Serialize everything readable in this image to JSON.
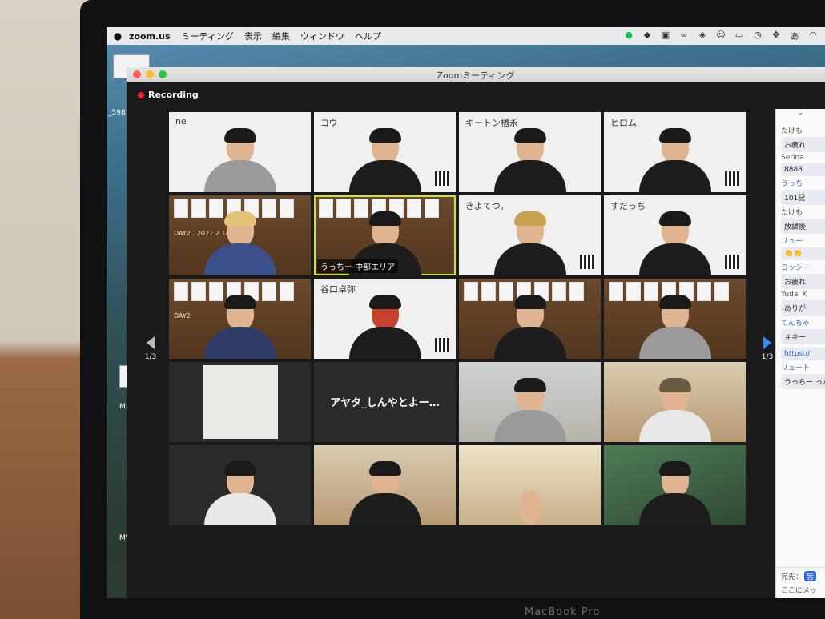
{
  "menubar": {
    "app": "zoom.us",
    "items": [
      "ミーティング",
      "表示",
      "編集",
      "ウィンドウ",
      "ヘルプ"
    ],
    "status_icons": [
      "line-icon",
      "evernote-icon",
      "zoom-icon",
      "creative-cloud-icon",
      "color-picker-icon",
      "accessibility-icon",
      "display-icon",
      "time-machine-icon",
      "move-icon",
      "input-method-icon",
      "wifi-icon"
    ],
    "input_method": "あ"
  },
  "window": {
    "title": "Zoomミーティング",
    "recording_label": "Recording"
  },
  "pager": {
    "prev_page": "1/3",
    "next_page": "1/3"
  },
  "tiles": [
    {
      "label": "ne",
      "badge": "",
      "center": "",
      "day": ""
    },
    {
      "label": "コウ",
      "badge": "",
      "center": "",
      "day": ""
    },
    {
      "label": "キートン楢永",
      "badge": "",
      "center": "",
      "day": ""
    },
    {
      "label": "ヒロム",
      "badge": "",
      "center": "",
      "day": ""
    },
    {
      "label": "",
      "badge": "",
      "center": "",
      "day": "DAY2　2021.2.14"
    },
    {
      "label": "",
      "badge": "うっちー 中部エリア",
      "center": "",
      "day": ""
    },
    {
      "label": "きよてつ。",
      "badge": "",
      "center": "",
      "day": ""
    },
    {
      "label": "すだっち",
      "badge": "",
      "center": "",
      "day": ""
    },
    {
      "label": "",
      "badge": "",
      "center": "",
      "day": "DAY2"
    },
    {
      "label": "谷口卓弥",
      "badge": "",
      "center": "",
      "day": ""
    },
    {
      "label": "",
      "badge": "",
      "center": "",
      "day": ""
    },
    {
      "label": "",
      "badge": "",
      "center": "",
      "day": ""
    },
    {
      "label": "",
      "badge": "",
      "center": "",
      "day": ""
    },
    {
      "label": "",
      "badge": "",
      "center": "アヤタ_しんやとよー…",
      "day": ""
    },
    {
      "label": "",
      "badge": "",
      "center": "",
      "day": ""
    },
    {
      "label": "",
      "badge": "",
      "center": "",
      "day": ""
    },
    {
      "label": "",
      "badge": "",
      "center": "",
      "day": ""
    },
    {
      "label": "",
      "badge": "",
      "center": "",
      "day": ""
    },
    {
      "label": "",
      "badge": "",
      "center": "",
      "day": ""
    },
    {
      "label": "",
      "badge": "",
      "center": "",
      "day": ""
    }
  ],
  "chat": {
    "messages": [
      {
        "sender": "たけも",
        "text": "お疲れ",
        "link": false
      },
      {
        "sender": "Serina",
        "text": "8888",
        "link": false
      },
      {
        "sender": "うっち",
        "text": "101記",
        "link": false
      },
      {
        "sender": "たけも",
        "text": "放課後",
        "link": false
      },
      {
        "sender": "リュー",
        "text": "👏👏",
        "link": false
      },
      {
        "sender": "ヨッシー",
        "text": "お疲れ",
        "link": false
      },
      {
        "sender": "Yudai K",
        "text": "ありが",
        "link": false
      },
      {
        "sender": "てんちゃ",
        "text": "＃キー",
        "link": false
      },
      {
        "sender": "",
        "text": "https://",
        "link": true
      },
      {
        "sender": "リュート",
        "text": "うっちー った",
        "link": false
      }
    ],
    "to_label": "宛先：",
    "to_chip": "皆",
    "input_placeholder": "ここにメッ"
  },
  "desktop": {
    "labels": [
      "_598",
      "Mとw",
      "MW自"
    ]
  },
  "hardware": {
    "model": "MacBook Pro"
  }
}
